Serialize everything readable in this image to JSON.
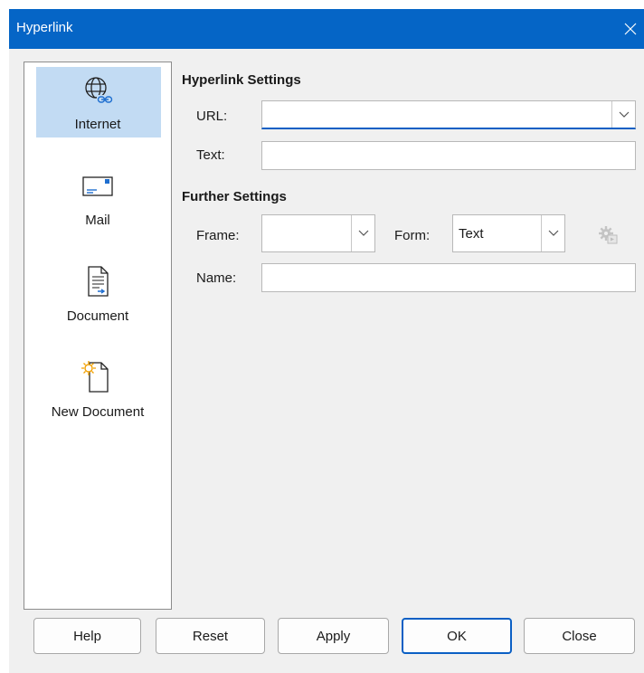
{
  "window": {
    "title": "Hyperlink"
  },
  "sidebar": {
    "items": [
      {
        "label": "Internet",
        "icon": "globe-link-icon",
        "selected": true
      },
      {
        "label": "Mail",
        "icon": "envelope-icon",
        "selected": false
      },
      {
        "label": "Document",
        "icon": "document-icon",
        "selected": false
      },
      {
        "label": "New Document",
        "icon": "new-document-icon",
        "selected": false
      }
    ]
  },
  "hyperlink_settings": {
    "title": "Hyperlink Settings",
    "url_label": "URL:",
    "url_value": "",
    "text_label": "Text:",
    "text_value": ""
  },
  "further_settings": {
    "title": "Further Settings",
    "frame_label": "Frame:",
    "frame_value": "",
    "form_label": "Form:",
    "form_value": "Text",
    "name_label": "Name:",
    "name_value": ""
  },
  "buttons": {
    "help": "Help",
    "reset": "Reset",
    "apply": "Apply",
    "ok": "OK",
    "close": "Close"
  },
  "colors": {
    "titlebar": "#0565c6",
    "selection": "#c2dbf3",
    "focus_accent": "#0a5fc4"
  }
}
